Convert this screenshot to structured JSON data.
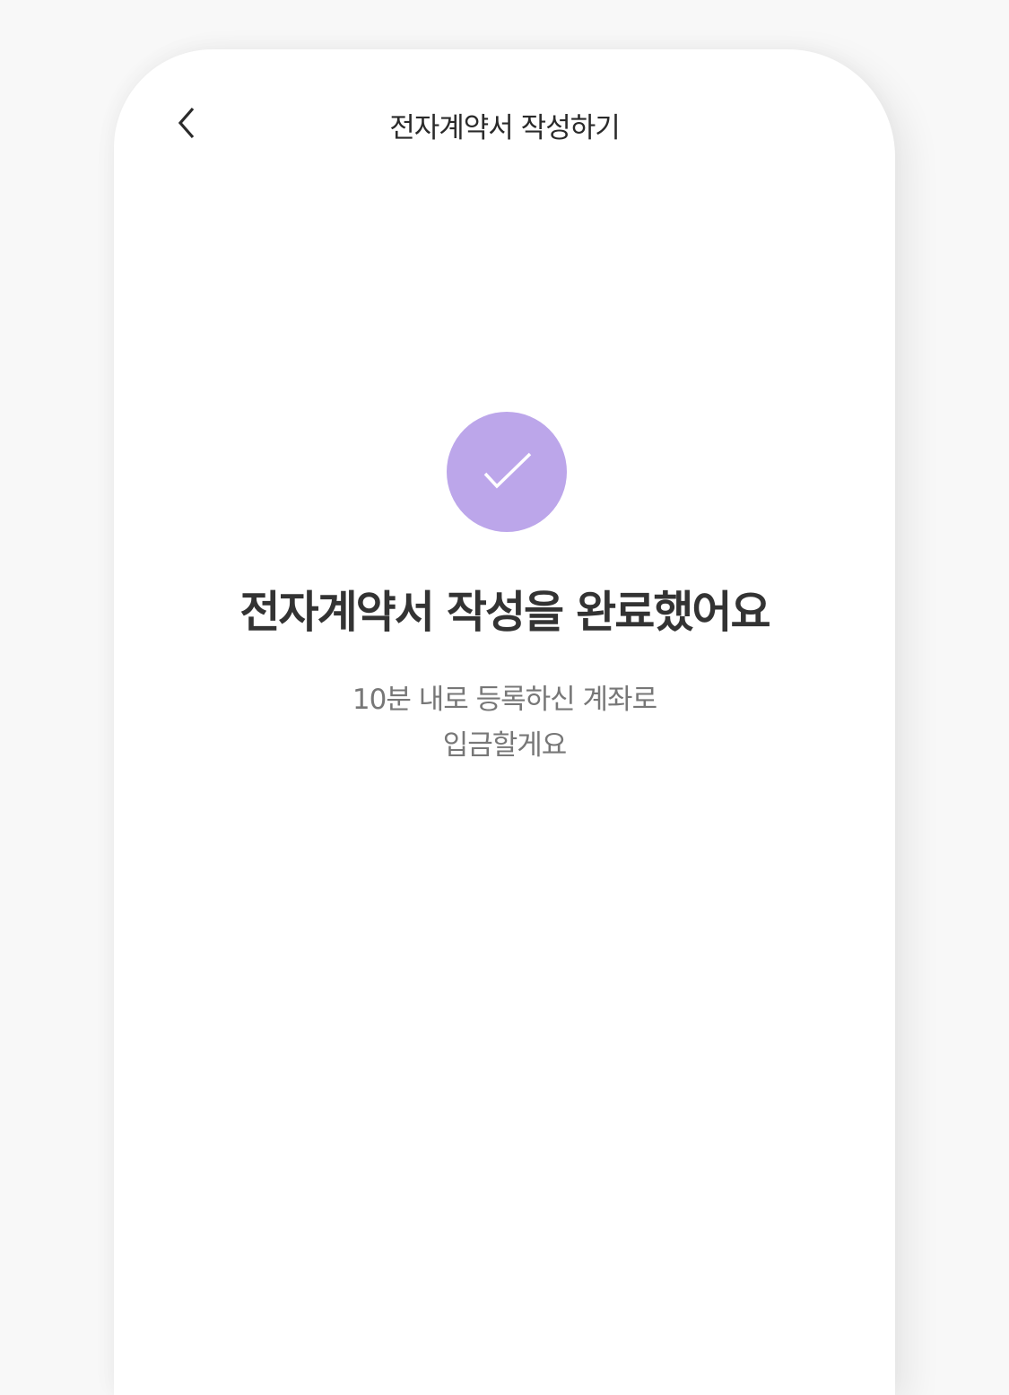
{
  "header": {
    "title": "전자계약서 작성하기",
    "back_icon": "chevron-left-icon"
  },
  "main": {
    "status_icon": "check-icon",
    "status_color": "#bca6ea",
    "title": "전자계약서 작성을 완료했어요",
    "subtitle_lines": [
      "10분 내로 등록하신 계좌로",
      "입금할게요"
    ]
  }
}
